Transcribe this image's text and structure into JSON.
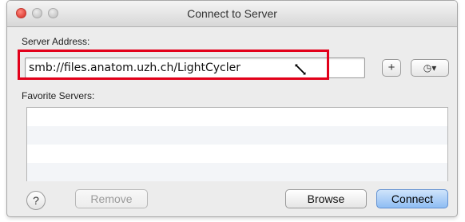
{
  "window": {
    "title": "Connect to Server"
  },
  "labels": {
    "server_address": "Server Address:",
    "favorite_servers": "Favorite Servers:"
  },
  "address_input": {
    "value": "smb://files.anatom.uzh.ch/LightCycler"
  },
  "buttons": {
    "add": "+",
    "history": "◷▾",
    "help": "?",
    "remove": "Remove",
    "browse": "Browse",
    "connect": "Connect"
  },
  "favorite_servers": [],
  "colors": {
    "highlight": "#e2001a",
    "connect_button": "#8fbdf3"
  },
  "icons": {
    "cursor": "resize-cursor-icon",
    "help": "question-icon",
    "history": "clock-icon"
  }
}
